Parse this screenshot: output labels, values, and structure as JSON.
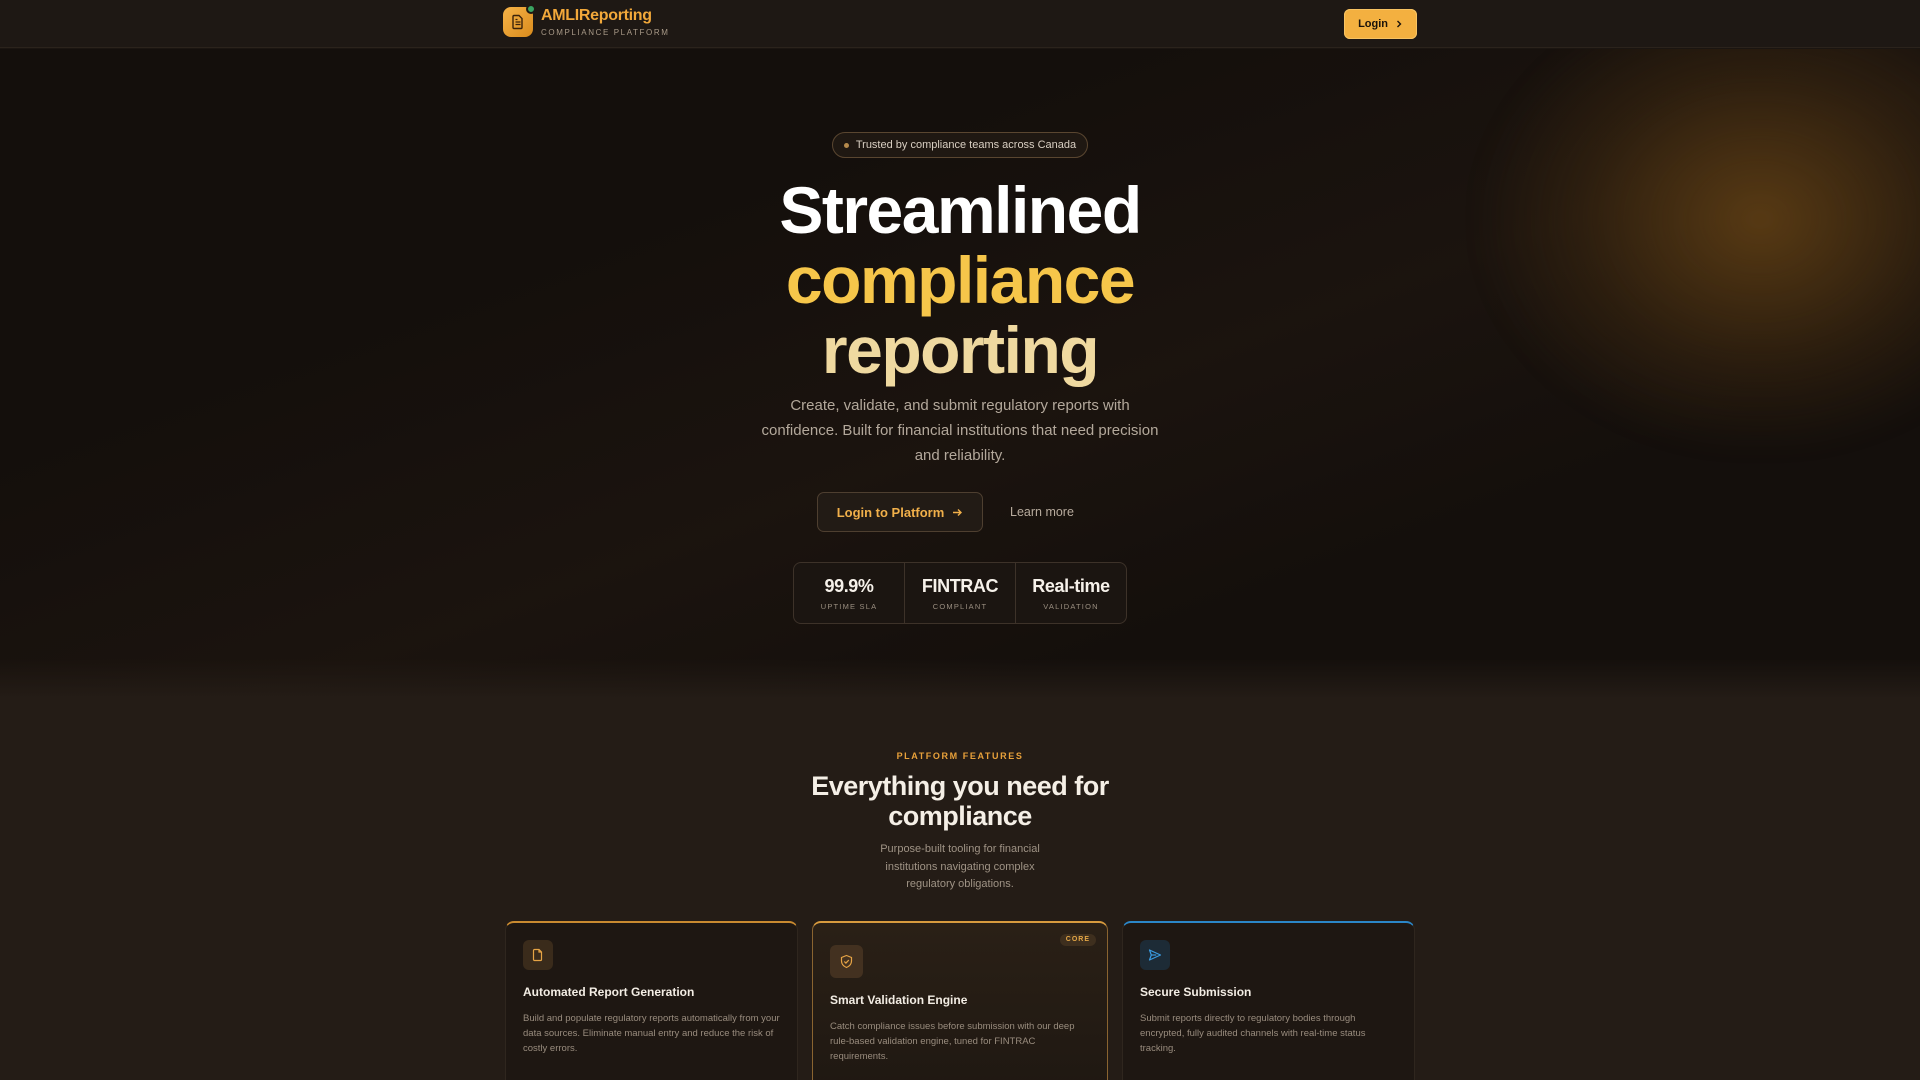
{
  "navbar": {
    "brand": "AMLIReporting",
    "tagline": "COMPLIANCE PLATFORM",
    "login_label": "Login"
  },
  "hero": {
    "badge": "Trusted by compliance teams across Canada",
    "title_line1": "Streamlined",
    "title_line2": "compliance",
    "title_line3": "reporting",
    "description": "Create, validate, and submit regulatory reports with confidence. Built for financial institutions that need precision and reliability.",
    "primary_cta": "Login to Platform",
    "secondary_cta": "Learn more",
    "stats": [
      {
        "value": "99.9%",
        "label": "UPTIME SLA"
      },
      {
        "value": "FINTRAC",
        "label": "COMPLIANT"
      },
      {
        "value": "Real-time",
        "label": "VALIDATION"
      }
    ]
  },
  "features": {
    "eyebrow": "PLATFORM FEATURES",
    "title": "Everything you need for compliance",
    "description": "Purpose-built tooling for financial institutions navigating complex regulatory obligations.",
    "cards": [
      {
        "title": "Automated Report Generation",
        "text": "Build and populate regulatory reports automatically from your data sources. Eliminate manual entry and reduce the risk of costly errors.",
        "icon": "document-icon"
      },
      {
        "title": "Smart Validation Engine",
        "text": "Catch compliance issues before submission with our deep rule-based validation engine, tuned for FINTRAC requirements.",
        "badge": "CORE",
        "icon": "shield-check-icon"
      },
      {
        "title": "Secure Submission",
        "text": "Submit reports directly to regulatory bodies through encrypted, fully audited channels with real-time status tracking.",
        "icon": "send-icon"
      }
    ]
  },
  "colors": {
    "accent": "#f3b040",
    "background": "#1b1511",
    "title_highlight": "#f6c64a",
    "secure_accent": "#2b86c7",
    "status_dot": "#3aa562"
  }
}
